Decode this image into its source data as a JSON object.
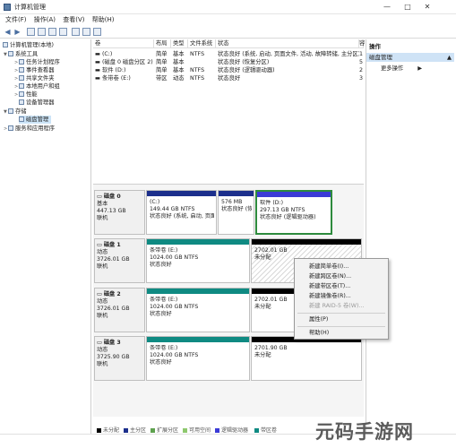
{
  "window": {
    "title": "计算机管理",
    "minimize": "—",
    "maximize": "□",
    "close": "✕"
  },
  "menu": [
    "文件(F)",
    "操作(A)",
    "查看(V)",
    "帮助(H)"
  ],
  "tree": {
    "root": "计算机管理(本地)",
    "system_tools": "系统工具",
    "task_scheduler": "任务计划程序",
    "event_viewer": "事件查看器",
    "shared_folders": "共享文件夹",
    "local_users": "本地用户和组",
    "performance": "性能",
    "device_manager": "设备管理器",
    "storage": "存储",
    "disk_management": "磁盘管理",
    "services": "服务和应用程序"
  },
  "volume_table": {
    "headers": [
      "卷",
      "布局",
      "类型",
      "文件系统",
      "状态",
      "容"
    ],
    "rows": [
      [
        "(C:)",
        "简单",
        "基本",
        "NTFS",
        "状态良好 (系统, 启动, 页面文件, 活动, 故障转储, 主分区)",
        "1"
      ],
      [
        "(磁盘 0 磁盘分区 2)",
        "简单",
        "基本",
        "",
        "状态良好 (恢复分区)",
        "5"
      ],
      [
        "软件 (D:)",
        "简单",
        "基本",
        "NTFS",
        "状态良好 (逻辑驱动器)",
        "2"
      ],
      [
        "条带卷 (E:)",
        "带区",
        "动态",
        "NTFS",
        "状态良好",
        "3"
      ]
    ]
  },
  "disks": [
    {
      "name": "磁盘 0",
      "type": "基本",
      "size": "447.13 GB",
      "status": "联机",
      "parts": [
        {
          "l1": "(C:)",
          "l2": "149.44 GB NTFS",
          "l3": "状态良好 (系统, 启动, 页面"
        },
        {
          "l1": "",
          "l2": "576 MB",
          "l3": "状态良好 (恢复"
        },
        {
          "l1": "软件 (D:)",
          "l2": "297.13 GB NTFS",
          "l3": "状态良好 (逻辑驱动器)"
        }
      ]
    },
    {
      "name": "磁盘 1",
      "type": "动态",
      "size": "3726.01 GB",
      "status": "联机",
      "parts": [
        {
          "l1": "条带卷 (E:)",
          "l2": "1024.00 GB NTFS",
          "l3": "状态良好"
        },
        {
          "l1": "",
          "l2": "2702.01 GB",
          "l3": "未分配"
        }
      ]
    },
    {
      "name": "磁盘 2",
      "type": "动态",
      "size": "3726.01 GB",
      "status": "联机",
      "parts": [
        {
          "l1": "条带卷 (E:)",
          "l2": "1024.00 GB NTFS",
          "l3": "状态良好"
        },
        {
          "l1": "",
          "l2": "2702.01 GB",
          "l3": "未分配"
        }
      ]
    },
    {
      "name": "磁盘 3",
      "type": "动态",
      "size": "3725.90 GB",
      "status": "联机",
      "parts": [
        {
          "l1": "条带卷 (E:)",
          "l2": "1024.00 GB NTFS",
          "l3": "状态良好"
        },
        {
          "l1": "",
          "l2": "2701.90 GB",
          "l3": "未分配"
        }
      ]
    }
  ],
  "legend": [
    "未分配",
    "主分区",
    "扩展分区",
    "可用空间",
    "逻辑驱动器",
    "带区卷"
  ],
  "colors": {
    "primary": "#1c2f8c",
    "logical": "#3b3bd6",
    "striped": "#0f8a82",
    "unallocated": "#000000",
    "extended": "#5ea14e",
    "free": "#8ec86e",
    "selection": "#2e8b3d"
  },
  "actions": {
    "header": "操作",
    "section": "磁盘管理",
    "more": "更多操作"
  },
  "context_menu": {
    "new_simple": "新建简单卷(I)...",
    "new_spanned": "新建跨区卷(N)...",
    "new_striped": "新建带区卷(T)...",
    "new_mirror": "新建镜像卷(R)...",
    "new_raid5": "新建 RAID-5 卷(W)...",
    "properties": "属性(P)",
    "help": "帮助(H)"
  },
  "watermark": "元码手游网"
}
